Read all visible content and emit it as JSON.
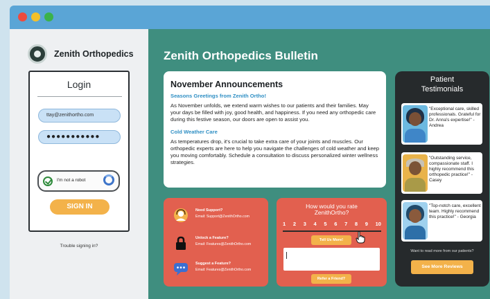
{
  "brand": {
    "name": "Zenith Orthopedics"
  },
  "login": {
    "title": "Login",
    "email_value": "ttay@zenithortho.com",
    "password_value": "●●●●●●●●●●●",
    "captcha_label": "I'm not a robot",
    "signin_label": "SIGN IN",
    "trouble_link": "Trouble signing in?"
  },
  "main": {
    "title": "Zenith Orthopedics Bulletin"
  },
  "announcements": {
    "heading": "November Announcements",
    "items": [
      {
        "subtitle": "Seasons Greetings from Zenith Ortho!",
        "text": "As November unfolds, we extend warm wishes to our patients and their families. May your days be filled with joy, good health, and happiness. If you need any orthopedic care during this festive season, our doors are open to assist you."
      },
      {
        "subtitle": "Cold Weather Care",
        "text": "As temperatures drop, it's crucial to take extra care of your joints and muscles. Our orthopedic experts are here to help you navigate the challenges of cold weather and keep you moving comfortably. Schedule a consultation to discuss personalized winter wellness strategies."
      }
    ]
  },
  "testimonials": {
    "title": "Patient Testimonials",
    "items": [
      {
        "quote": "\"Exceptional care, skilled professionals. Grateful for Dr. Anna's expertise!\" - Andrea"
      },
      {
        "quote": "\"Outstanding service, compassionate staff. I highly recommend this orthopedic practice!\" - Casey"
      },
      {
        "quote": "\"Top-notch care, excellent team. Highly recommend this practice!\" - Georgia"
      }
    ],
    "footer": "Want to read more from our patients?",
    "button_label": "See More Reviews"
  },
  "support": {
    "items": [
      {
        "title": "Need Support?",
        "detail": "Email: Support@ZenithOrtho.com",
        "icon": "headset-icon"
      },
      {
        "title": "Unlock a Feature?",
        "detail": "Email: Features@ZenithOrtho.com",
        "icon": "lock-icon"
      },
      {
        "title": "Suggest a Feature?",
        "detail": "Email: Features@ZenithOrtho.com",
        "icon": "chat-icon"
      }
    ]
  },
  "rating": {
    "question": "How would you rate ZenithOrtho?",
    "scale": [
      "1",
      "2",
      "3",
      "4",
      "5",
      "6",
      "7",
      "8",
      "9",
      "10"
    ],
    "selected": "8",
    "tell_button": "Tell Us More!",
    "refer_button": "Refer a Friend?"
  },
  "colors": {
    "titlebar": "#5aa5d6",
    "main_bg": "#3f8e7f",
    "accent_orange": "#f3b24a",
    "card_coral": "#e2604f",
    "testimonials_bg": "#262a2c"
  }
}
